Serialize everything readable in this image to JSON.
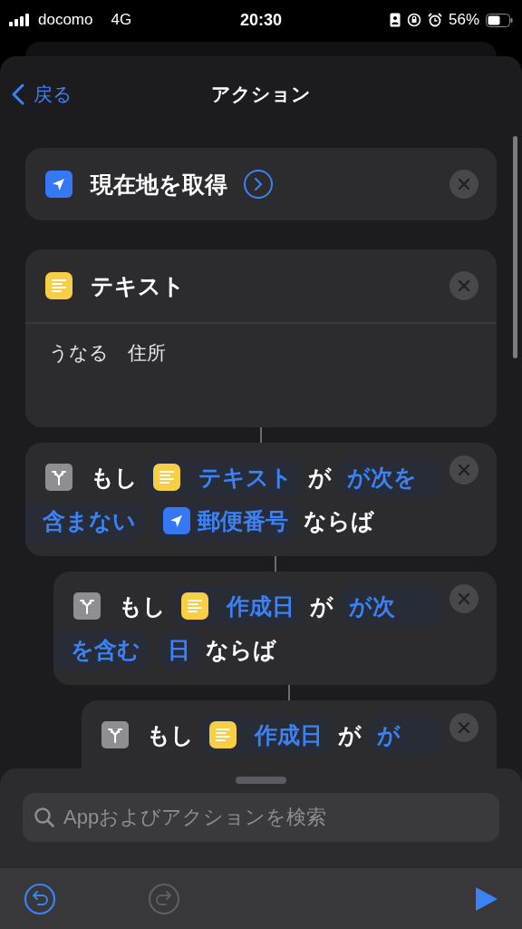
{
  "status_bar": {
    "carrier": "docomo",
    "network": "4G",
    "time": "20:30",
    "battery": "56%"
  },
  "nav": {
    "back": "戻る",
    "title": "アクション"
  },
  "actions": [
    {
      "kind": "action",
      "title": "現在地を取得",
      "expandable": true
    },
    {
      "kind": "text",
      "title": "テキスト",
      "body": "うなる　住所"
    },
    {
      "kind": "if",
      "lines": [
        [
          {
            "kind": "word",
            "text": "もし"
          },
          {
            "kind": "text_variable",
            "text": "テキスト"
          },
          {
            "kind": "word",
            "text": "が"
          },
          {
            "kind": "param",
            "text": "が次を"
          }
        ],
        [
          {
            "kind": "param",
            "text": "含まない"
          },
          {
            "kind": "location_variable",
            "text": "郵便番号"
          },
          {
            "kind": "word",
            "text": "ならば"
          }
        ]
      ],
      "children": [
        {
          "kind": "if",
          "lines": [
            [
              {
                "kind": "word",
                "text": "もし"
              },
              {
                "kind": "text_variable",
                "text": "作成日"
              },
              {
                "kind": "word",
                "text": "が"
              },
              {
                "kind": "param",
                "text": "が次"
              }
            ],
            [
              {
                "kind": "param",
                "text": "を含む"
              },
              {
                "kind": "param",
                "text": "日"
              },
              {
                "kind": "word",
                "text": "ならば"
              }
            ]
          ],
          "children": [
            {
              "kind": "if",
              "lines": [
                [
                  {
                    "kind": "word",
                    "text": "もし"
                  },
                  {
                    "kind": "text_variable",
                    "text": "作成日"
                  },
                  {
                    "kind": "word",
                    "text": "が"
                  },
                  {
                    "kind": "param",
                    "text": "が"
                  }
                ]
              ]
            }
          ]
        }
      ]
    }
  ],
  "search": {
    "placeholder": "Appおよびアクションを検索"
  },
  "toolbar": {
    "undo": {
      "disabled": false
    },
    "redo": {
      "disabled": true
    }
  }
}
